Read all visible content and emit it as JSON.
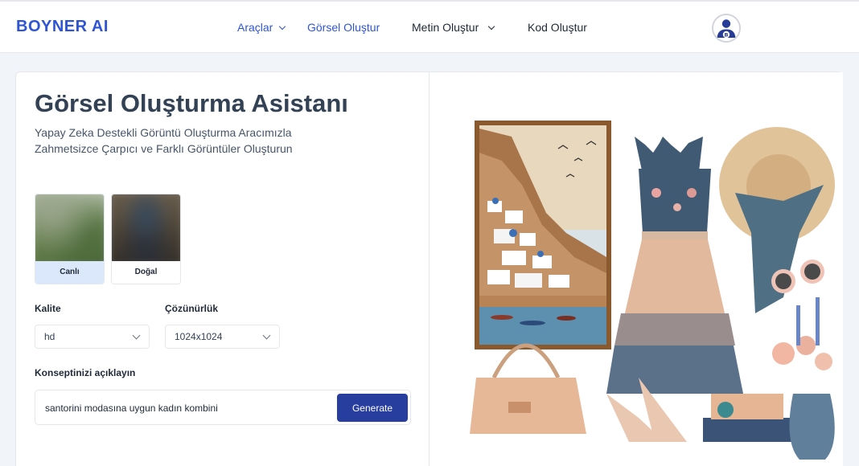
{
  "header": {
    "logo": "BOYNER AI",
    "nav": [
      {
        "label": "Araçlar",
        "has_dropdown": true,
        "active": true
      },
      {
        "label": "Görsel Oluştur",
        "has_dropdown": false,
        "active": true
      },
      {
        "label": "Metin Oluştur",
        "has_dropdown": true,
        "active": false
      },
      {
        "label": "Kod Oluştur",
        "has_dropdown": false,
        "active": false
      }
    ],
    "avatar_letter": "B"
  },
  "main": {
    "title": "Görsel Oluşturma Asistanı",
    "subtitle": "Yapay Zeka Destekli Görüntü Oluşturma Aracımızla Zahmetsizce Çarpıcı ve Farklı Görüntüler Oluşturun",
    "styles": [
      {
        "label": "Canlı",
        "selected": true
      },
      {
        "label": "Doğal",
        "selected": false
      }
    ],
    "quality": {
      "label": "Kalite",
      "value": "hd"
    },
    "resolution": {
      "label": "Çözünürlük",
      "value": "1024x1024"
    },
    "prompt": {
      "label": "Konseptinizi açıklayın",
      "value": "santorini modasına uygun kadın kombini",
      "button": "Generate"
    }
  },
  "colors": {
    "brand": "#2f55d4",
    "button": "#283e9e",
    "selected_tile": "#dbe7fb",
    "background": "#f1f4f8"
  },
  "icons": [
    "chevron-down-icon",
    "user-avatar-icon"
  ]
}
